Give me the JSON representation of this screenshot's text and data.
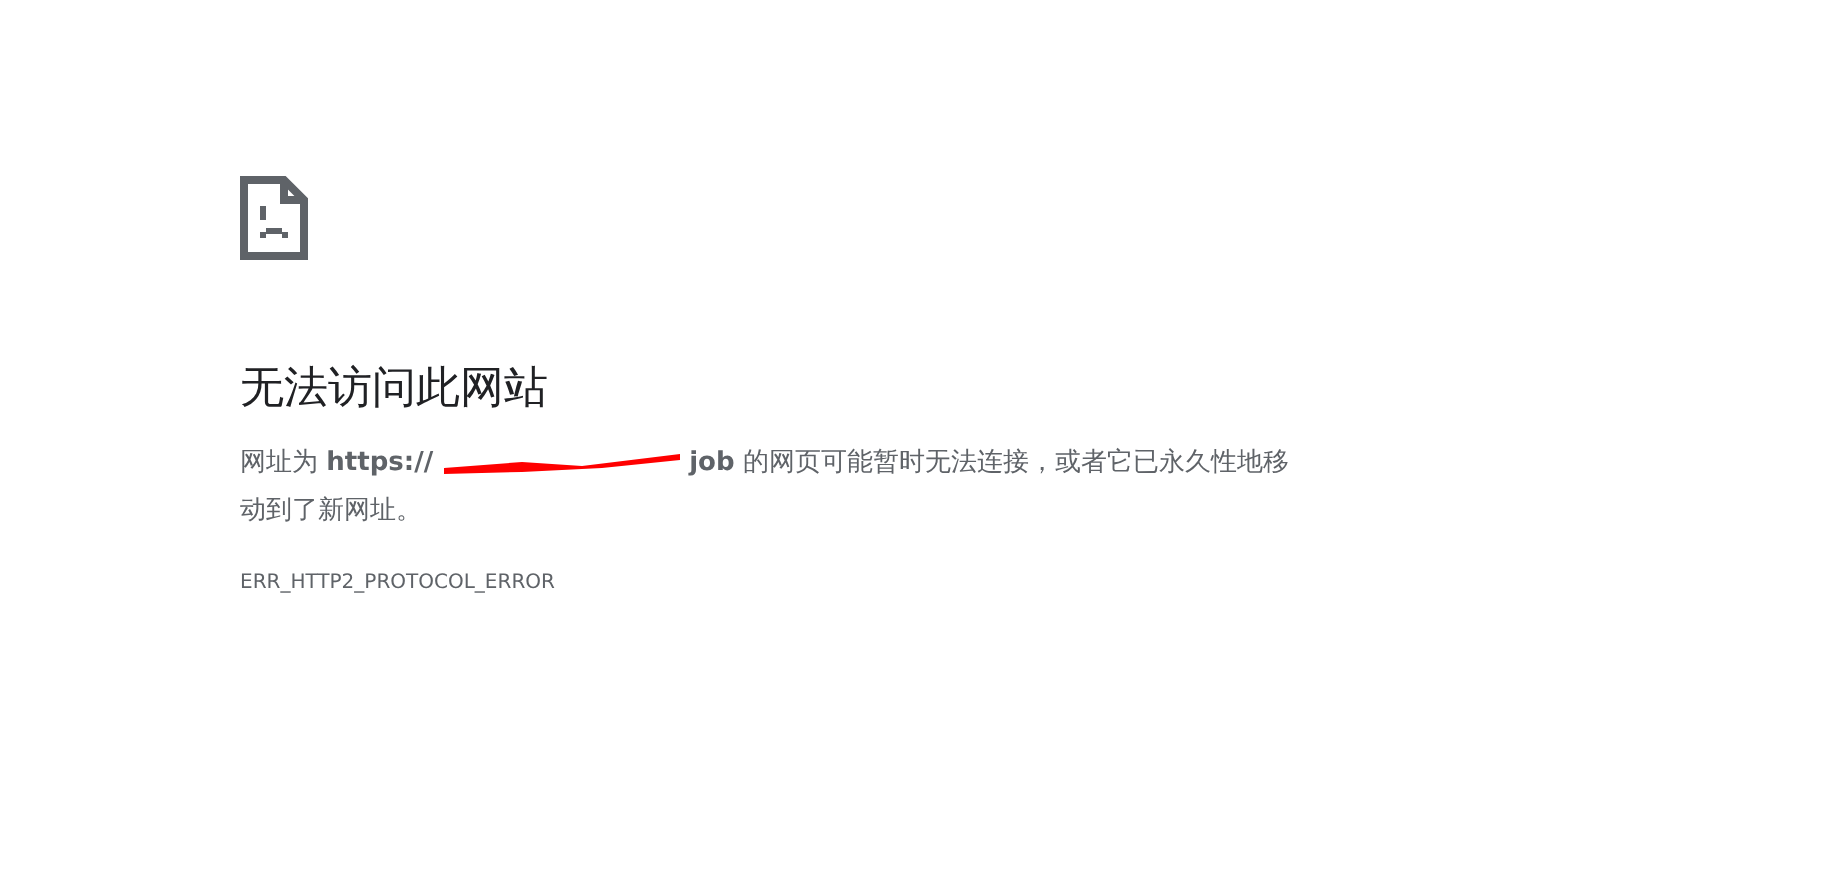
{
  "heading": "无法访问此网站",
  "message": {
    "before": "网址为 **https://**",
    "after": "**job** 的网页可能暂时无法连接，或者它已永久性地移",
    "continued": "动到了新网址。"
  },
  "error_code": "ERR_HTTP2_PROTOCOL_ERROR"
}
